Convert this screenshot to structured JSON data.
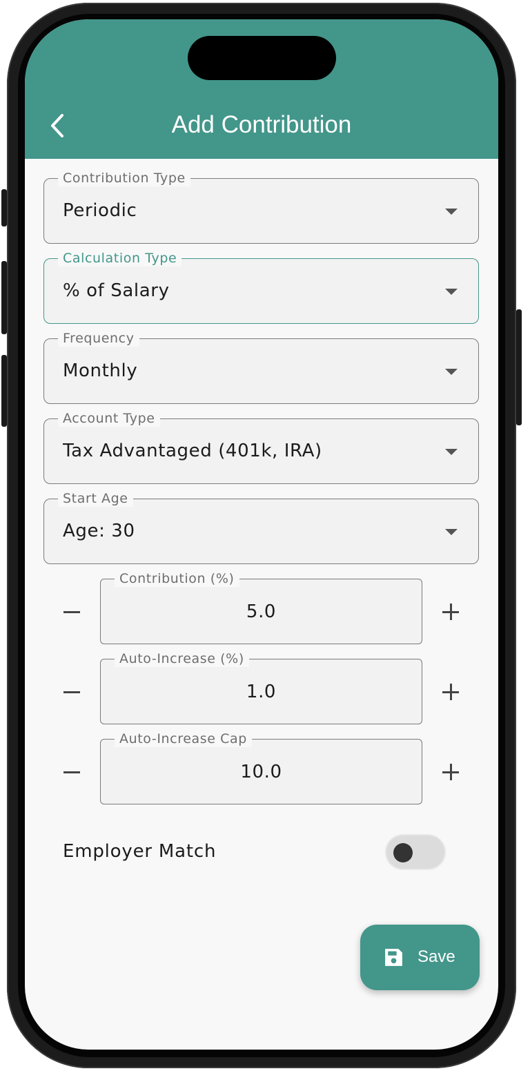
{
  "appbar": {
    "title": "Add Contribution"
  },
  "fields": [
    {
      "label": "Contribution Type",
      "value": "Periodic"
    },
    {
      "label": "Calculation Type",
      "value": "% of Salary"
    },
    {
      "label": "Frequency",
      "value": "Monthly"
    },
    {
      "label": "Account Type",
      "value": "Tax Advantaged (401k, IRA)"
    },
    {
      "label": "Start Age",
      "value": "Age: 30"
    }
  ],
  "steppers": [
    {
      "label": "Contribution (%)",
      "value": "5.0"
    },
    {
      "label": "Auto-Increase (%)",
      "value": "1.0"
    },
    {
      "label": "Auto-Increase Cap",
      "value": "10.0"
    }
  ],
  "employer_match": {
    "label": "Employer Match",
    "enabled": false
  },
  "save": {
    "label": "Save"
  },
  "colors": {
    "accent": "#43968a",
    "background": "#f8f8f8"
  },
  "icons": {
    "back": "chevron-left-icon",
    "dropdown": "caret-down-icon",
    "save": "floppy-disk-icon"
  }
}
